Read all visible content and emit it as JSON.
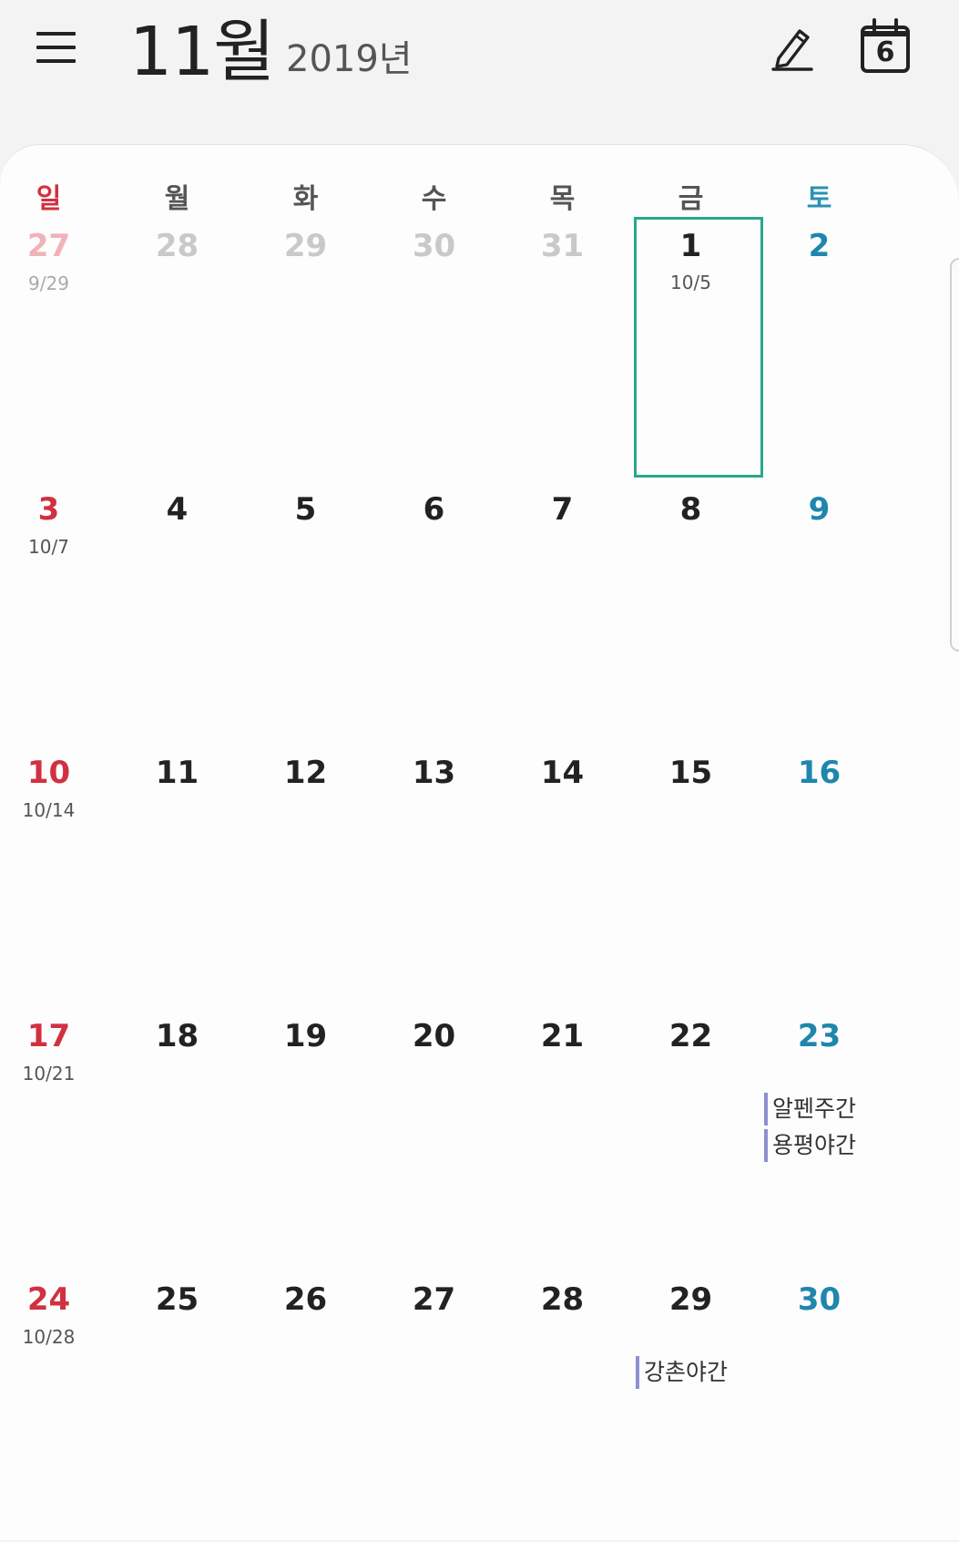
{
  "header": {
    "month": "11월",
    "year": "2019년",
    "menu_icon": "hamburger-menu-icon",
    "edit_icon": "pencil-edit-icon",
    "today_icon": "calendar-today-icon",
    "today_number": "6"
  },
  "weekdays": [
    "일",
    "월",
    "화",
    "수",
    "목",
    "금",
    "토"
  ],
  "colors": {
    "sunday": "#d23040",
    "saturday": "#1f86ad",
    "selected_border": "#2aa68c",
    "event_bar": "#8e8fd0"
  },
  "weeks": [
    [
      {
        "day": "27",
        "lunar": "9/29",
        "outside": true
      },
      {
        "day": "28",
        "outside": true
      },
      {
        "day": "29",
        "outside": true
      },
      {
        "day": "30",
        "outside": true
      },
      {
        "day": "31",
        "outside": true
      },
      {
        "day": "1",
        "lunar": "10/5",
        "selected": true
      },
      {
        "day": "2"
      }
    ],
    [
      {
        "day": "3",
        "lunar": "10/7"
      },
      {
        "day": "4"
      },
      {
        "day": "5"
      },
      {
        "day": "6"
      },
      {
        "day": "7"
      },
      {
        "day": "8"
      },
      {
        "day": "9"
      }
    ],
    [
      {
        "day": "10",
        "lunar": "10/14"
      },
      {
        "day": "11"
      },
      {
        "day": "12"
      },
      {
        "day": "13"
      },
      {
        "day": "14"
      },
      {
        "day": "15"
      },
      {
        "day": "16"
      }
    ],
    [
      {
        "day": "17",
        "lunar": "10/21"
      },
      {
        "day": "18"
      },
      {
        "day": "19"
      },
      {
        "day": "20"
      },
      {
        "day": "21"
      },
      {
        "day": "22"
      },
      {
        "day": "23",
        "events": [
          "알펜주간",
          "용평야간"
        ]
      }
    ],
    [
      {
        "day": "24",
        "lunar": "10/28"
      },
      {
        "day": "25"
      },
      {
        "day": "26"
      },
      {
        "day": "27"
      },
      {
        "day": "28"
      },
      {
        "day": "29",
        "events": [
          "강촌야간"
        ]
      },
      {
        "day": "30"
      }
    ]
  ]
}
